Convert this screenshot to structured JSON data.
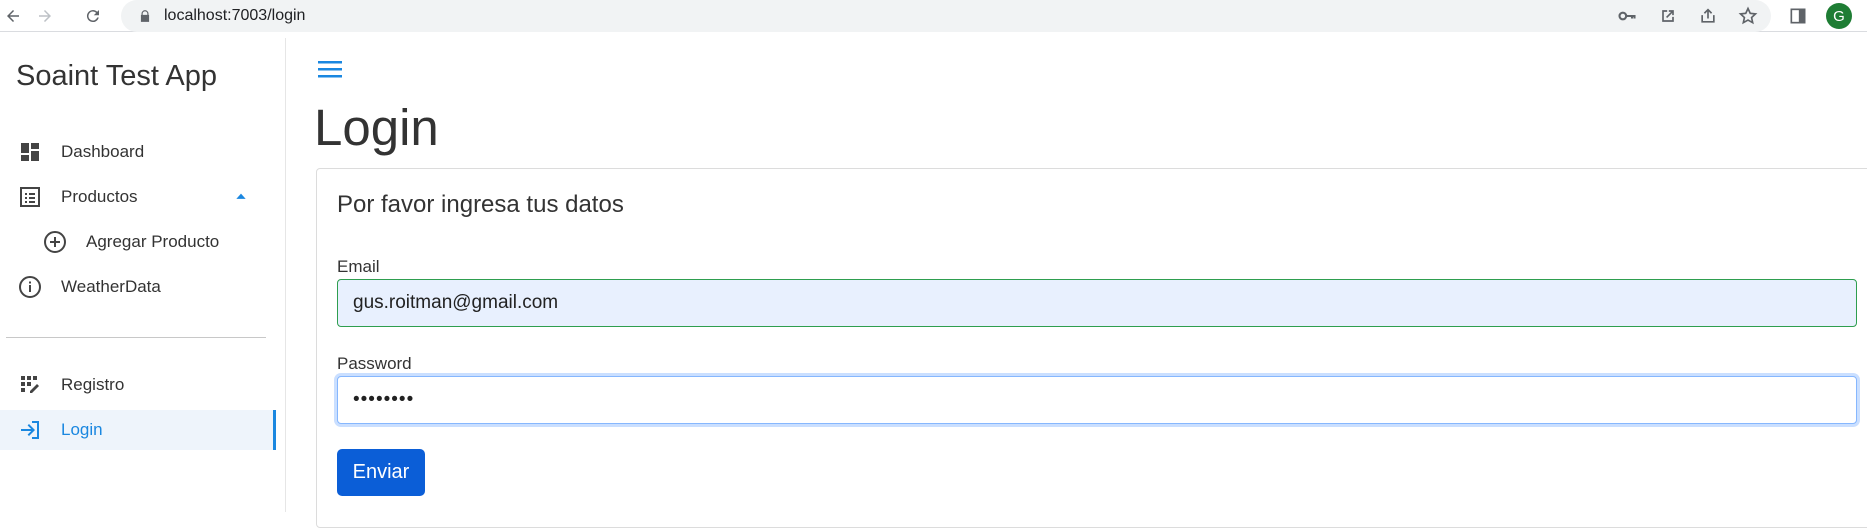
{
  "browser": {
    "url": "localhost:7003/login",
    "profile_initial": "G",
    "profile_color": "#1e7d34"
  },
  "sidebar": {
    "title": "Soaint Test App",
    "items": [
      {
        "label": "Dashboard",
        "icon": "dashboard-icon"
      },
      {
        "label": "Productos",
        "icon": "list-icon",
        "expanded": true
      },
      {
        "label": "Agregar Producto",
        "icon": "add-circle-icon"
      },
      {
        "label": "WeatherData",
        "icon": "info-icon"
      },
      {
        "label": "Registro",
        "icon": "registro-icon"
      },
      {
        "label": "Login",
        "icon": "login-icon",
        "active": true
      }
    ]
  },
  "main": {
    "title": "Login",
    "card_title": "Por favor ingresa tus datos",
    "email_label": "Email",
    "email_value": "gus.roitman@gmail.com",
    "password_label": "Password",
    "password_value": "••••••••",
    "submit_label": "Enviar"
  },
  "colors": {
    "accent": "#1a87e0",
    "button": "#0b5ed7",
    "autofill_bg": "#e8f0fe"
  }
}
